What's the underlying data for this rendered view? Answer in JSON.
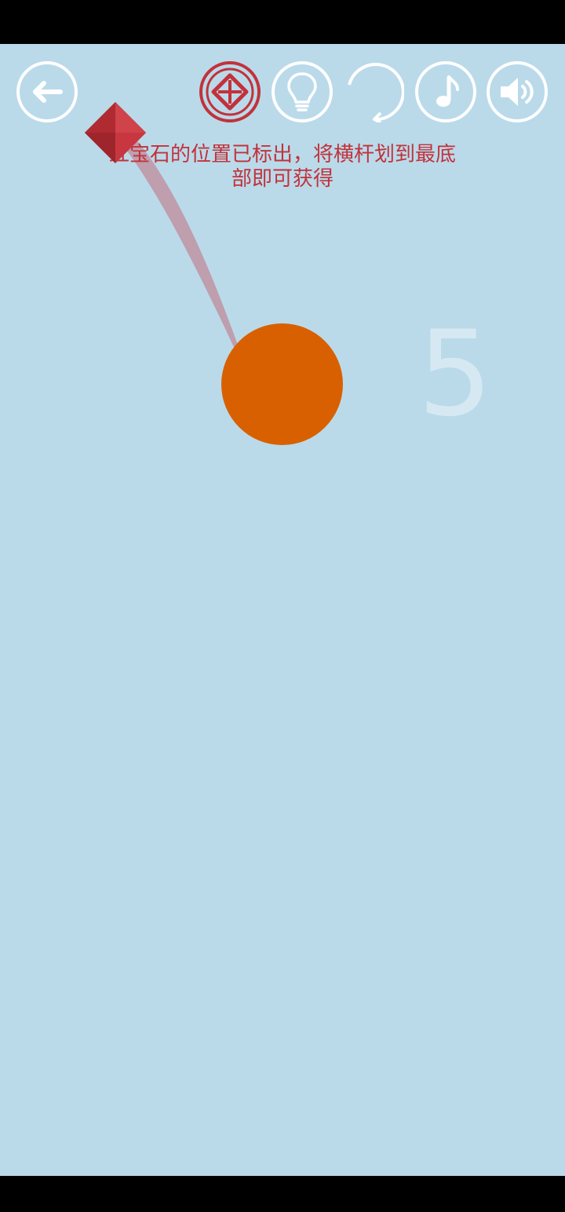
{
  "toolbar": {
    "back_icon": "back-arrow-icon",
    "gem_icon": "gem-locator-icon",
    "hint_icon": "lightbulb-icon",
    "restart_icon": "restart-icon",
    "music_icon": "music-note-icon",
    "sound_icon": "speaker-icon"
  },
  "game": {
    "hint_line1": "红宝石的位置已标出，将横杆划到最底",
    "hint_line2": "部即可获得",
    "score": "5"
  },
  "colors": {
    "background": "#badaea",
    "ball": "#d96000",
    "gem": "#c2323a",
    "hint_text": "#c2323a",
    "score": "#d6e9f3",
    "icon_outline": "#ffffff"
  }
}
